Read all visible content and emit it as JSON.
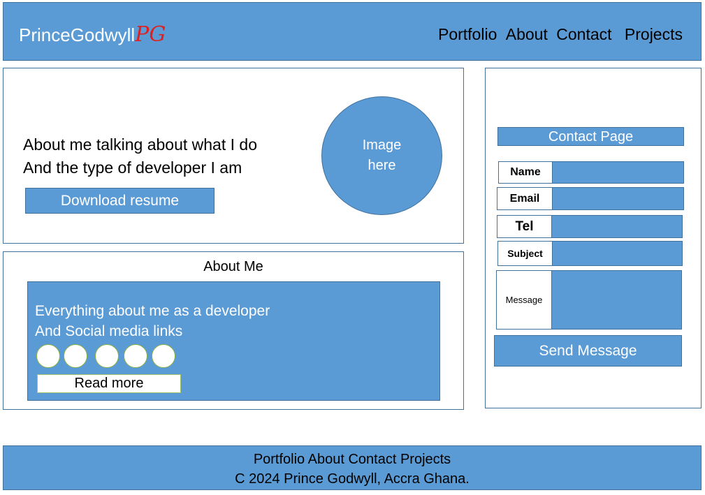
{
  "header": {
    "brand": "PrinceGodwyll",
    "brand_mark": "PG",
    "nav": [
      "Portfolio",
      "About",
      "Contact",
      "Projects"
    ]
  },
  "hero": {
    "line1": "About me talking about what I do",
    "line2": "And the type of developer I am",
    "resume_button": "Download resume",
    "image_placeholder_line1": "Image",
    "image_placeholder_line2": "here"
  },
  "about": {
    "title": "About Me",
    "line1": "Everything about me as a developer",
    "line2": "And Social media links",
    "social_link_count": 5,
    "read_more": "Read more"
  },
  "contact": {
    "title": "Contact Page",
    "fields": [
      {
        "label": "Name"
      },
      {
        "label": "Email"
      },
      {
        "label": "Tel"
      },
      {
        "label": "Subject"
      },
      {
        "label": "Message"
      }
    ],
    "send_button": "Send Message"
  },
  "footer": {
    "nav": "Portfolio About Contact  Projects",
    "copyright": "C 2024 Prince Godwyll, Accra Ghana."
  },
  "colors": {
    "primary": "#5b9bd5",
    "border": "#41719c",
    "brand_mark": "#e02020"
  }
}
